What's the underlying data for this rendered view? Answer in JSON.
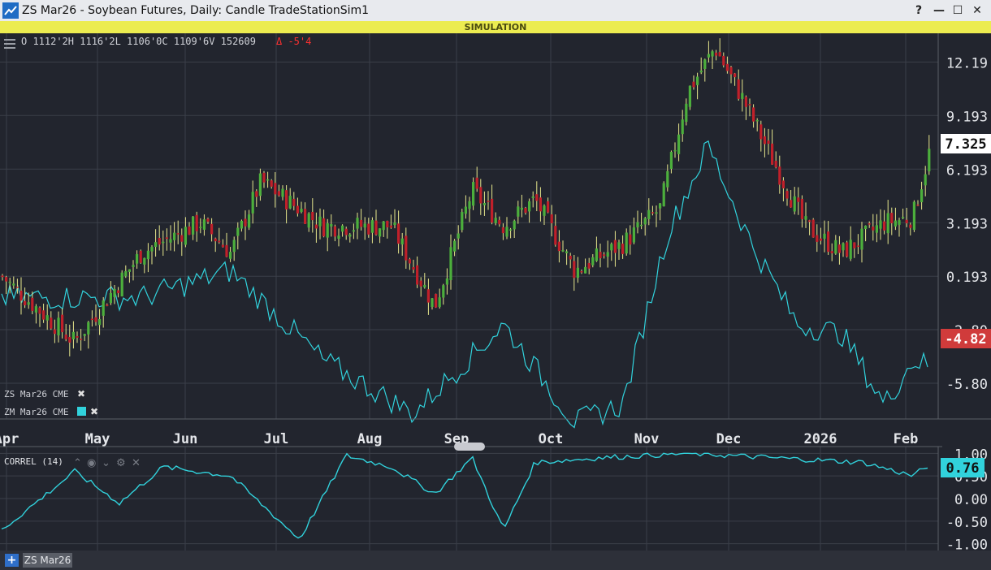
{
  "window": {
    "title": "ZS Mar26 - Soybean Futures, Daily: Candle TradeStationSim1",
    "help_label": "?",
    "minimize_label": "—",
    "maximize_label": "☐",
    "close_label": "✕"
  },
  "simulation_banner": "SIMULATION",
  "ohlc_header": {
    "text": "O 1112'2H 1116'2L 1106'0C 1109'6V 152609",
    "change": "Δ -5'4"
  },
  "legend": {
    "symbol1": "ZS Mar26 CME",
    "symbol2": "ZM Mar26 CME",
    "symbol2_color": "#31d2dc"
  },
  "colors": {
    "background": "#22252e",
    "grid": "#3b3f49",
    "candle_up": "#4caf3c",
    "candle_down": "#c0202a",
    "wick": "#e6e68c",
    "correl_line": "#31d2dc",
    "price_last_tag": "#ffffff",
    "zm_last_tag": "#d03b3b"
  },
  "price_axis": {
    "labels": [
      "12.19",
      "9.193",
      "6.193",
      "3.193",
      "0.193",
      "-2.80",
      "-5.80"
    ],
    "last_price_tag": "7.325",
    "zm_last_tag": "-4.82"
  },
  "date_axis": {
    "labels": [
      "Apr",
      "May",
      "Jun",
      "Jul",
      "Aug",
      "Sep",
      "Oct",
      "Nov",
      "Dec",
      "2026",
      "Feb"
    ]
  },
  "correl_pane": {
    "label": "CORREL (14)",
    "axis_labels": [
      "1.00",
      "0.50",
      "0.00",
      "-0.50",
      "-1.00"
    ],
    "last_tag": "0.76"
  },
  "bottom": {
    "add_tab_label": "+",
    "tab_label": "ZS Mar26"
  },
  "chart_data": [
    {
      "type": "candlestick",
      "title": "ZS Mar26 - Soybean Futures, Daily: Candle",
      "series": [
        {
          "name": "ZS Mar26 CME",
          "key_points": [
            {
              "date": "Apr",
              "close": 0.2
            },
            {
              "date": "Apr",
              "close": -3.5
            },
            {
              "date": "May",
              "close": 1.5
            },
            {
              "date": "Jun",
              "close": 3.2
            },
            {
              "date": "Jun",
              "close": 1.5
            },
            {
              "date": "Jun",
              "close": 5.5
            },
            {
              "date": "Jul",
              "close": 3.0
            },
            {
              "date": "Aug",
              "close": 3.0
            },
            {
              "date": "Aug",
              "close": -1.5
            },
            {
              "date": "Sep",
              "close": 5.0
            },
            {
              "date": "Sep",
              "close": 3.0
            },
            {
              "date": "Sep",
              "close": 4.5
            },
            {
              "date": "Oct",
              "close": 0.5
            },
            {
              "date": "Oct",
              "close": 2.0
            },
            {
              "date": "Nov",
              "close": 4.0
            },
            {
              "date": "Nov",
              "close": 10.5
            },
            {
              "date": "Nov",
              "close": 13.0
            },
            {
              "date": "Dec",
              "close": 10.0
            },
            {
              "date": "Dec",
              "close": 6.5
            },
            {
              "date": "Dec",
              "close": 3.0
            },
            {
              "date": "2026",
              "close": 1.5
            },
            {
              "date": "2026",
              "close": 3.2
            },
            {
              "date": "Feb",
              "close": 3.5
            },
            {
              "date": "Feb",
              "close": 7.3
            }
          ]
        },
        {
          "name": "ZM Mar26 CME",
          "key_points": [
            {
              "date": "Apr",
              "value": -1.0
            },
            {
              "date": "May",
              "value": -1.0
            },
            {
              "date": "Jun",
              "value": 0.5
            },
            {
              "date": "Jul",
              "value": -4.5
            },
            {
              "date": "Aug",
              "value": -7.5
            },
            {
              "date": "Sep",
              "value": -2.5
            },
            {
              "date": "Oct",
              "value": -8.0
            },
            {
              "date": "Oct",
              "value": -7.0
            },
            {
              "date": "Nov",
              "value": 2.5
            },
            {
              "date": "Nov",
              "value": 7.5
            },
            {
              "date": "Dec",
              "value": 2.0
            },
            {
              "date": "Dec",
              "value": -2.5
            },
            {
              "date": "2026",
              "value": -3.0
            },
            {
              "date": "2026",
              "value": -7.0
            },
            {
              "date": "Feb",
              "value": -4.5
            },
            {
              "date": "Feb",
              "value": -4.82
            }
          ]
        }
      ],
      "ylim": [
        -7.8,
        13.8
      ],
      "y_ticks": [
        12.19,
        9.193,
        6.193,
        3.193,
        0.193,
        -2.8,
        -5.8
      ],
      "grid": true
    },
    {
      "type": "line",
      "title": "CORREL (14)",
      "series": [
        {
          "name": "CORREL (14)",
          "key_points": [
            {
              "date": "Apr",
              "value": -0.7
            },
            {
              "date": "Apr",
              "value": 0.6
            },
            {
              "date": "May",
              "value": -0.1
            },
            {
              "date": "May",
              "value": 0.7
            },
            {
              "date": "Jun",
              "value": 0.5
            },
            {
              "date": "Jul",
              "value": -0.9
            },
            {
              "date": "Jul",
              "value": 0.95
            },
            {
              "date": "Aug",
              "value": 0.7
            },
            {
              "date": "Aug",
              "value": 0.1
            },
            {
              "date": "Sep",
              "value": 0.9
            },
            {
              "date": "Sep",
              "value": -0.7
            },
            {
              "date": "Sep",
              "value": 0.8
            },
            {
              "date": "Oct",
              "value": 0.9
            },
            {
              "date": "Nov",
              "value": 1.0
            },
            {
              "date": "Dec",
              "value": 0.9
            },
            {
              "date": "2026",
              "value": 0.8
            },
            {
              "date": "Feb",
              "value": 0.5
            },
            {
              "date": "Feb",
              "value": 0.76
            }
          ]
        }
      ],
      "ylim": [
        -1.15,
        1.15
      ],
      "y_ticks": [
        1.0,
        0.5,
        0.0,
        -0.5,
        -1.0
      ],
      "grid": true
    }
  ]
}
